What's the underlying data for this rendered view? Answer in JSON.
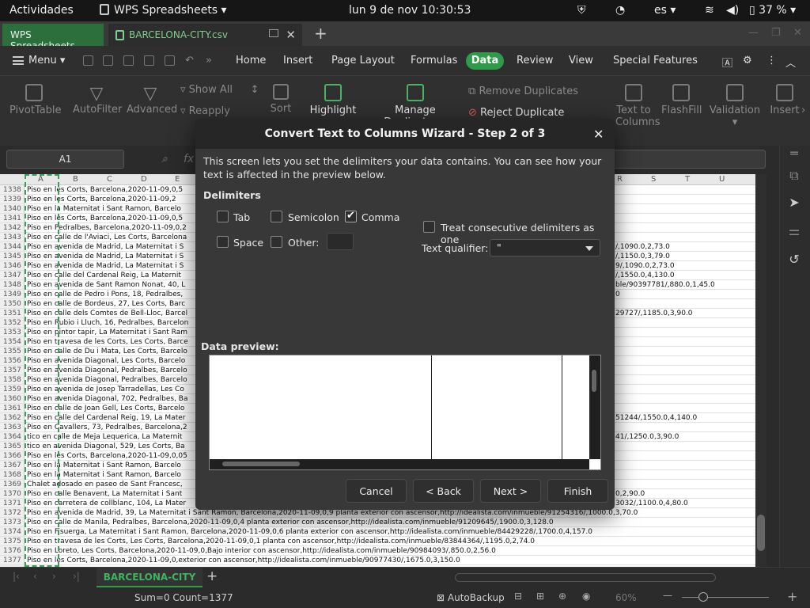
{
  "topbar": {
    "activities": "Actividades",
    "app_name": "WPS Spreadsheets",
    "clock": "lun  9 de nov  10:30:53",
    "lang": "es",
    "battery": "37 %"
  },
  "tabs": {
    "home_tab": "WPS Spreadsheets",
    "file_tab": "BARCELONA-CITY.csv"
  },
  "menu": {
    "menu_label": "Menu",
    "items": [
      "Home",
      "Insert",
      "Page Layout",
      "Formulas",
      "Data",
      "Review",
      "View",
      "Special Features"
    ],
    "active": "Data"
  },
  "ribbon": {
    "pivot": "PivotTable",
    "autofilter": "AutoFilter",
    "advanced": "Advanced",
    "show_all": "Show All",
    "reapply": "Reapply",
    "sort": "Sort",
    "highlight": "Highlight",
    "manage_dup": "Manage Duplicates",
    "remove_dup": "Remove Duplicates",
    "reject_dup": "Reject Duplicate Entries",
    "text_to_cols_1": "Text to",
    "text_to_cols_2": "Columns",
    "flashfill": "FlashFill",
    "validation": "Validation",
    "insert": "Insert"
  },
  "formula_bar": {
    "name_box": "A1",
    "fx": "fx"
  },
  "columns": [
    "A",
    "B",
    "C",
    "D",
    "E",
    "R",
    "S",
    "T",
    "U"
  ],
  "rows": [
    {
      "n": "1338",
      "left": "Piso en les Corts, Barcelona,2020-11-09,0,5",
      "right": ""
    },
    {
      "n": "1339",
      "left": "Piso en les Corts, Barcelona,2020-11-09,2",
      "right": ""
    },
    {
      "n": "1340",
      "left": "Piso en la Maternitat i Sant Ramon, Barcelo",
      "right": ""
    },
    {
      "n": "1341",
      "left": "Piso en les Corts, Barcelona,2020-11-09,0,5",
      "right": ""
    },
    {
      "n": "1342",
      "left": "Piso en Pedralbes, Barcelona,2020-11-09,0,2",
      "right": ""
    },
    {
      "n": "1343",
      "left": "Piso en calle de l'Aviaci, Les Corts, Barcelona",
      "right": ""
    },
    {
      "n": "1344",
      "left": "Piso en avenida de Madrid, La Maternitat i S",
      "right": "/,1090.0,2,73.0"
    },
    {
      "n": "1345",
      "left": "Piso en avenida de Madrid, La Maternitat i S",
      "right": "/,1150.0,3,79.0"
    },
    {
      "n": "1346",
      "left": "Piso en avenida de Madrid, La Maternitat i S",
      "right": "9/,1090.0,2,73.0"
    },
    {
      "n": "1347",
      "left": "Piso en calle del Cardenal Reig, La Maternit",
      "right": "/,1550.0,4,130.0"
    },
    {
      "n": "1348",
      "left": "Piso en avenida de Sant Ramon Nonat, 40, L",
      "right": "ble/90397781/,880.0,1,45.0"
    },
    {
      "n": "1349",
      "left": "Piso en calle de Pedro i Pons, 18, Pedralbes,",
      "right": "0"
    },
    {
      "n": "1350",
      "left": "Piso en calle de Bordeus, 27, Les Corts, Barc",
      "right": ""
    },
    {
      "n": "1351",
      "left": "Piso en calle dels Comtes de Bell-Lloc, Barcel",
      "right": "29727/,1185.0,3,90.0"
    },
    {
      "n": "1352",
      "left": "Piso en Rubio i Lluch, 16, Pedralbes, Barcelon",
      "right": ""
    },
    {
      "n": "1353",
      "left": "Piso en pintor tapir, La Maternitat i Sant Ram",
      "right": ""
    },
    {
      "n": "1354",
      "left": "Piso en travesa de les Corts, Les Corts, Barce",
      "right": ""
    },
    {
      "n": "1355",
      "left": "Piso en calle de Du i Mata, Les Corts, Barcelo",
      "right": ""
    },
    {
      "n": "1356",
      "left": "Piso en avenida Diagonal, Les Corts, Barcelo",
      "right": ""
    },
    {
      "n": "1357",
      "left": "Piso en avenida Diagonal, Pedralbes, Barcelo",
      "right": ""
    },
    {
      "n": "1358",
      "left": "Piso en avenida Diagonal, Pedralbes, Barcelo",
      "right": ""
    },
    {
      "n": "1359",
      "left": "Piso en avenida de Josep Tarradellas, Les Co",
      "right": ""
    },
    {
      "n": "1360",
      "left": "Piso en avenida Diagonal, 702, Pedralbes, Ba",
      "right": ""
    },
    {
      "n": "1361",
      "left": "Piso en calle de Joan Gell, Les Corts, Barcelo",
      "right": ""
    },
    {
      "n": "1362",
      "left": "Piso en calle del Cardenal Reig, 19, La Mater",
      "right": "51244/,1550.0,4,140.0"
    },
    {
      "n": "1363",
      "left": "Piso en Cavallers, 73, Pedralbes, Barcelona,2",
      "right": ""
    },
    {
      "n": "1364",
      "left": "tico en calle de Meja Lequerica, La Maternit",
      "right": "41/,1250.0,3,90.0"
    },
    {
      "n": "1365",
      "left": "tico en avenida Diagonal, 529, Les Corts, Ba",
      "right": ""
    },
    {
      "n": "1366",
      "left": "Piso en les Corts, Barcelona,2020-11-09,0,05",
      "right": ""
    },
    {
      "n": "1367",
      "left": "Piso en la Maternitat i Sant Ramon, Barcelo",
      "right": ""
    },
    {
      "n": "1368",
      "left": "Piso en la Maternitat i Sant Ramon, Barcelo",
      "right": ""
    },
    {
      "n": "1369",
      "left": "Chalet adosado en paseo de Sant Francesc,",
      "right": ""
    },
    {
      "n": "1370",
      "left": "Piso en calle Benavent, La Maternitat i Sant",
      "right": "0,2,90.0"
    },
    {
      "n": "1371",
      "left": "Piso en carretera de collblanc, 104, La Mater",
      "right": "3032/,1100.0,4,80.0"
    },
    {
      "n": "1372",
      "left": "Piso en avenida de Madrid, 39, La Maternitat i Sant Ramon, Barcelona,2020-11-09,0,9 planta exterior con ascensor,http://idealista.com/inmueble/91254316/,1000.0,3,70.0",
      "right": ""
    },
    {
      "n": "1373",
      "left": "Piso en calle de Manila, Pedralbes, Barcelona,2020-11-09,0,4 planta exterior con ascensor,http://idealista.com/inmueble/91209645/,1900.0,3,128.0",
      "right": ""
    },
    {
      "n": "1374",
      "left": "Piso en Fisuerga, La Maternitat i Sant Ramon, Barcelona,2020-11-09,0,6 planta exterior con ascensor,http://idealista.com/inmueble/84429228/,1700.0,4,157.0",
      "right": ""
    },
    {
      "n": "1375",
      "left": "Piso en travesa de les Corts, Les Corts, Barcelona,2020-11-09,0,1 planta  con ascensor,http://idealista.com/inmueble/83844364/,1195.0,2,74.0",
      "right": ""
    },
    {
      "n": "1376",
      "left": "Piso en Loreto, Les Corts, Barcelona,2020-11-09,0,Bajo interior con ascensor,http://idealista.com/inmueble/90984093/,850.0,2,56.0",
      "right": ""
    },
    {
      "n": "1377",
      "left": "Piso en les Corts, Barcelona,2020-11-09,0,exterior con ascensor,http://idealista.com/inmueble/90977430/,1675.0,3,150.0",
      "right": ""
    }
  ],
  "sheet_tab": "BARCELONA-CITY",
  "status": {
    "summary": "Sum=0  Count=1377",
    "autobackup": "AutoBackup",
    "zoom": "60%"
  },
  "dialog": {
    "title": "Convert Text to Columns Wizard - Step 2 of 3",
    "description": "This screen lets you set the delimiters your data contains. You can see how your text is affected in the preview below.",
    "delimiters_label": "Delimiters",
    "tab": "Tab",
    "semicolon": "Semicolon",
    "comma": "Comma",
    "space": "Space",
    "other": "Other:",
    "consecutive": "Treat consecutive delimiters as one",
    "qualifier_label": "Text qualifier:",
    "qualifier_value": "\"",
    "preview_label": "Data preview:",
    "checked": {
      "tab": false,
      "semicolon": false,
      "comma": true,
      "space": false,
      "other": false,
      "consecutive": false
    },
    "buttons": {
      "cancel": "Cancel",
      "back": "< Back",
      "next": "Next >",
      "finish": "Finish"
    }
  },
  "colors": {
    "accent": "#2f9a4a",
    "dialog_bg": "#383838",
    "title_bg": "#262626"
  }
}
